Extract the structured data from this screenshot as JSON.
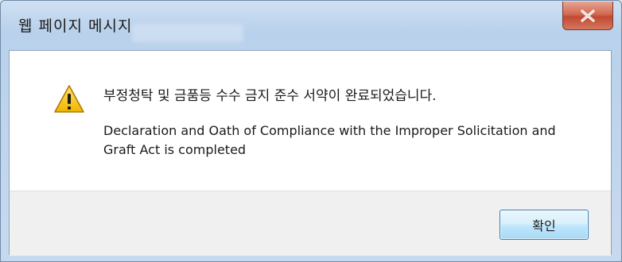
{
  "window": {
    "title": "웹 페이지 메시지"
  },
  "message": {
    "korean": "부정청탁 및 금품등 수수 금지 준수 서약이 완료되었습니다.",
    "english": "Declaration and Oath of Compliance with the Improper Solicitation and Graft Act is completed"
  },
  "buttons": {
    "ok_label": "확인"
  },
  "icons": {
    "message_icon": "warning-icon",
    "close_icon": "close-icon"
  },
  "colors": {
    "close_button": "#c9563c",
    "warning_fill": "#f5c518",
    "ok_border": "#3c7fb1"
  }
}
